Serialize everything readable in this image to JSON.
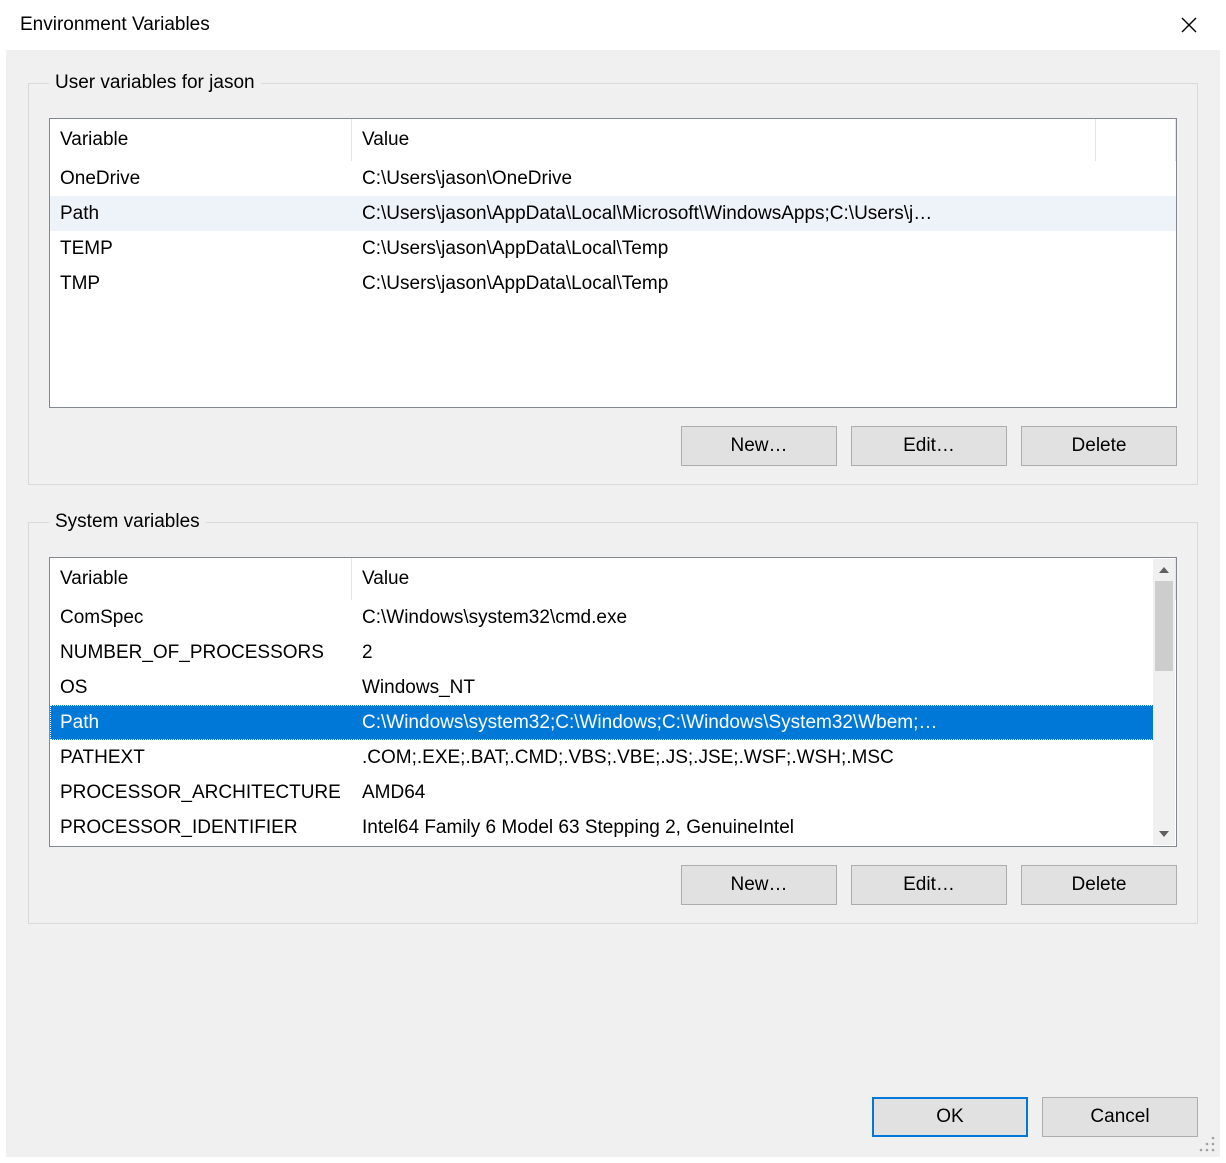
{
  "window": {
    "title": "Environment Variables"
  },
  "user_group": {
    "legend": "User variables for jason",
    "columns": {
      "variable": "Variable",
      "value": "Value"
    },
    "rows": [
      {
        "name": "OneDrive",
        "value": "C:\\Users\\jason\\OneDrive",
        "sel": ""
      },
      {
        "name": "Path",
        "value": "C:\\Users\\jason\\AppData\\Local\\Microsoft\\WindowsApps;C:\\Users\\j…",
        "sel": "light"
      },
      {
        "name": "TEMP",
        "value": "C:\\Users\\jason\\AppData\\Local\\Temp",
        "sel": ""
      },
      {
        "name": "TMP",
        "value": "C:\\Users\\jason\\AppData\\Local\\Temp",
        "sel": ""
      }
    ],
    "buttons": {
      "new": "New…",
      "edit": "Edit…",
      "delete": "Delete"
    }
  },
  "system_group": {
    "legend": "System variables",
    "columns": {
      "variable": "Variable",
      "value": "Value"
    },
    "rows": [
      {
        "name": "ComSpec",
        "value": "C:\\Windows\\system32\\cmd.exe",
        "sel": ""
      },
      {
        "name": "NUMBER_OF_PROCESSORS",
        "value": "2",
        "sel": ""
      },
      {
        "name": "OS",
        "value": "Windows_NT",
        "sel": ""
      },
      {
        "name": "Path",
        "value": "C:\\Windows\\system32;C:\\Windows;C:\\Windows\\System32\\Wbem;…",
        "sel": "selected"
      },
      {
        "name": "PATHEXT",
        "value": ".COM;.EXE;.BAT;.CMD;.VBS;.VBE;.JS;.JSE;.WSF;.WSH;.MSC",
        "sel": ""
      },
      {
        "name": "PROCESSOR_ARCHITECTURE",
        "value": "AMD64",
        "sel": ""
      },
      {
        "name": "PROCESSOR_IDENTIFIER",
        "value": "Intel64 Family 6 Model 63 Stepping 2, GenuineIntel",
        "sel": ""
      }
    ],
    "buttons": {
      "new": "New…",
      "edit": "Edit…",
      "delete": "Delete"
    }
  },
  "footer": {
    "ok": "OK",
    "cancel": "Cancel"
  }
}
